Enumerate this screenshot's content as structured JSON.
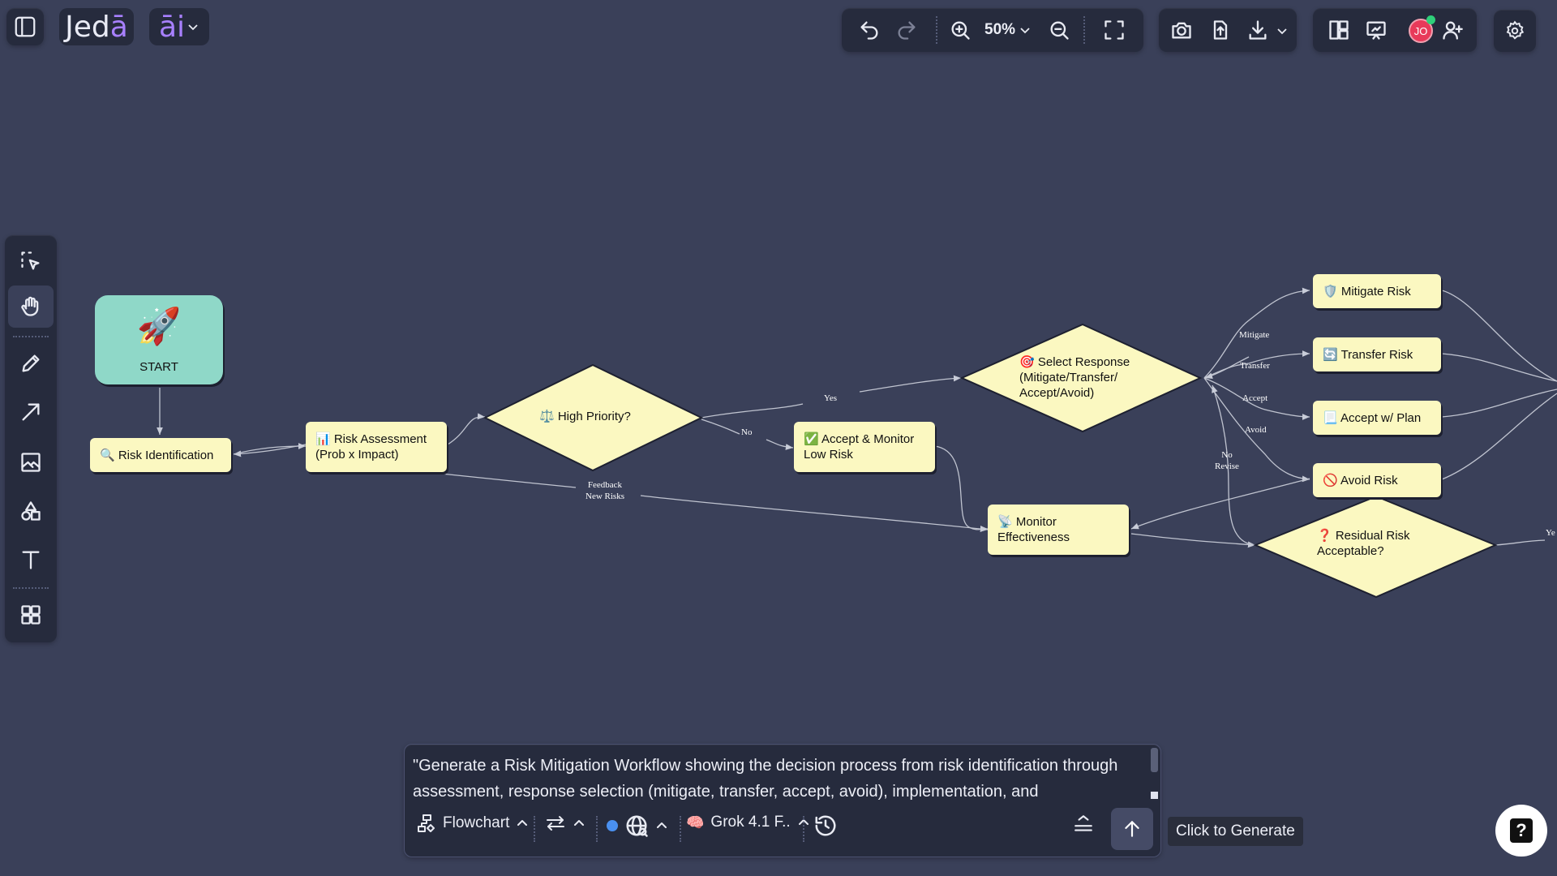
{
  "brand": {
    "name_plain": "Jed",
    "name_accent": "ā",
    "ai_plain": "",
    "ai_accent": "āi"
  },
  "toolbar": {
    "zoom": "50%"
  },
  "user": {
    "initials": "JO",
    "accent": "#e83a5a",
    "online": "#2fd07a"
  },
  "colors": {
    "background": "#3a4059",
    "panel": "#262b3d",
    "node_fill": "#fbf8c1",
    "start_fill": "#8fd8c8"
  },
  "nodes": {
    "start": "START",
    "risk_identification": "🔍 Risk Identification",
    "risk_assessment_1": "📊 Risk Assessment",
    "risk_assessment_2": "(Prob x Impact)",
    "high_priority": "⚖️ High Priority?",
    "accept_monitor_1": "✅ Accept & Monitor",
    "accept_monitor_2": "Low Risk",
    "select_response_1": "🎯 Select Response",
    "select_response_2": "(Mitigate/Transfer/",
    "select_response_3": "Accept/Avoid)",
    "monitor_1": "📡 Monitor",
    "monitor_2": "Effectiveness",
    "mitigate": "🛡️ Mitigate Risk",
    "transfer": "🔄 Transfer Risk",
    "accept_plan": "📃 Accept w/ Plan",
    "avoid": "🚫 Avoid Risk",
    "residual_1": "❓ Residual Risk",
    "residual_2": "Acceptable?"
  },
  "edge_labels": {
    "yes": "Yes",
    "no": "No",
    "feedback_1": "Feedback",
    "feedback_2": "New Risks",
    "mitigate": "Mitigate",
    "transfer": "Transfer",
    "accept": "Accept",
    "avoid": "Avoid",
    "no_revise_1": "No",
    "no_revise_2": "Revise",
    "yes_right": "Ye"
  },
  "prompt": {
    "text": "\"Generate a Risk Mitigation Workflow showing the decision process from risk identification through assessment, response selection (mitigate, transfer, accept, avoid), implementation, and",
    "diagram_type": "Flowchart",
    "model": "Grok 4.1 F..",
    "tooltip": "Click to Generate"
  },
  "help": "?"
}
